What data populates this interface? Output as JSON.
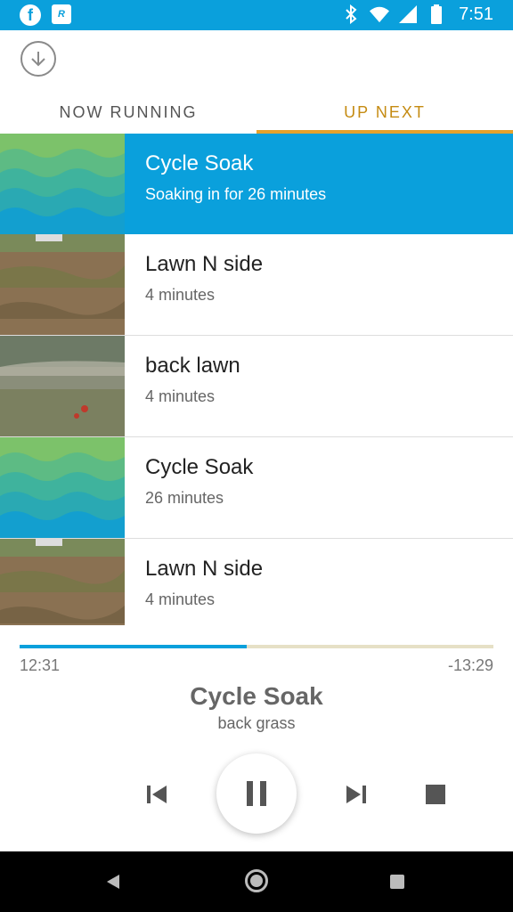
{
  "status_bar": {
    "time": "7:51",
    "bg_color": "#0aa0dc"
  },
  "header": {
    "tabs": [
      {
        "label": "NOW RUNNING",
        "selected": false
      },
      {
        "label": "UP NEXT",
        "selected": true
      }
    ]
  },
  "queue": [
    {
      "title": "Cycle Soak",
      "subtitle": "Soaking in for 26 minutes",
      "thumb": "waves",
      "active": true
    },
    {
      "title": "Lawn N side",
      "subtitle": "4 minutes",
      "thumb": "lawn-dirt",
      "active": false
    },
    {
      "title": "back lawn",
      "subtitle": "4 minutes",
      "thumb": "lawn-grass",
      "active": false
    },
    {
      "title": "Cycle Soak",
      "subtitle": "26 minutes",
      "thumb": "waves",
      "active": false
    },
    {
      "title": "Lawn N side",
      "subtitle": "4 minutes",
      "thumb": "lawn-dirt",
      "active": false
    }
  ],
  "player": {
    "elapsed": "12:31",
    "remaining": "-13:29",
    "progress": 0.48,
    "title": "Cycle Soak",
    "subtitle": "back grass"
  },
  "colors": {
    "accent": "#0aa0dc",
    "tab_accent": "#e5a22c"
  }
}
